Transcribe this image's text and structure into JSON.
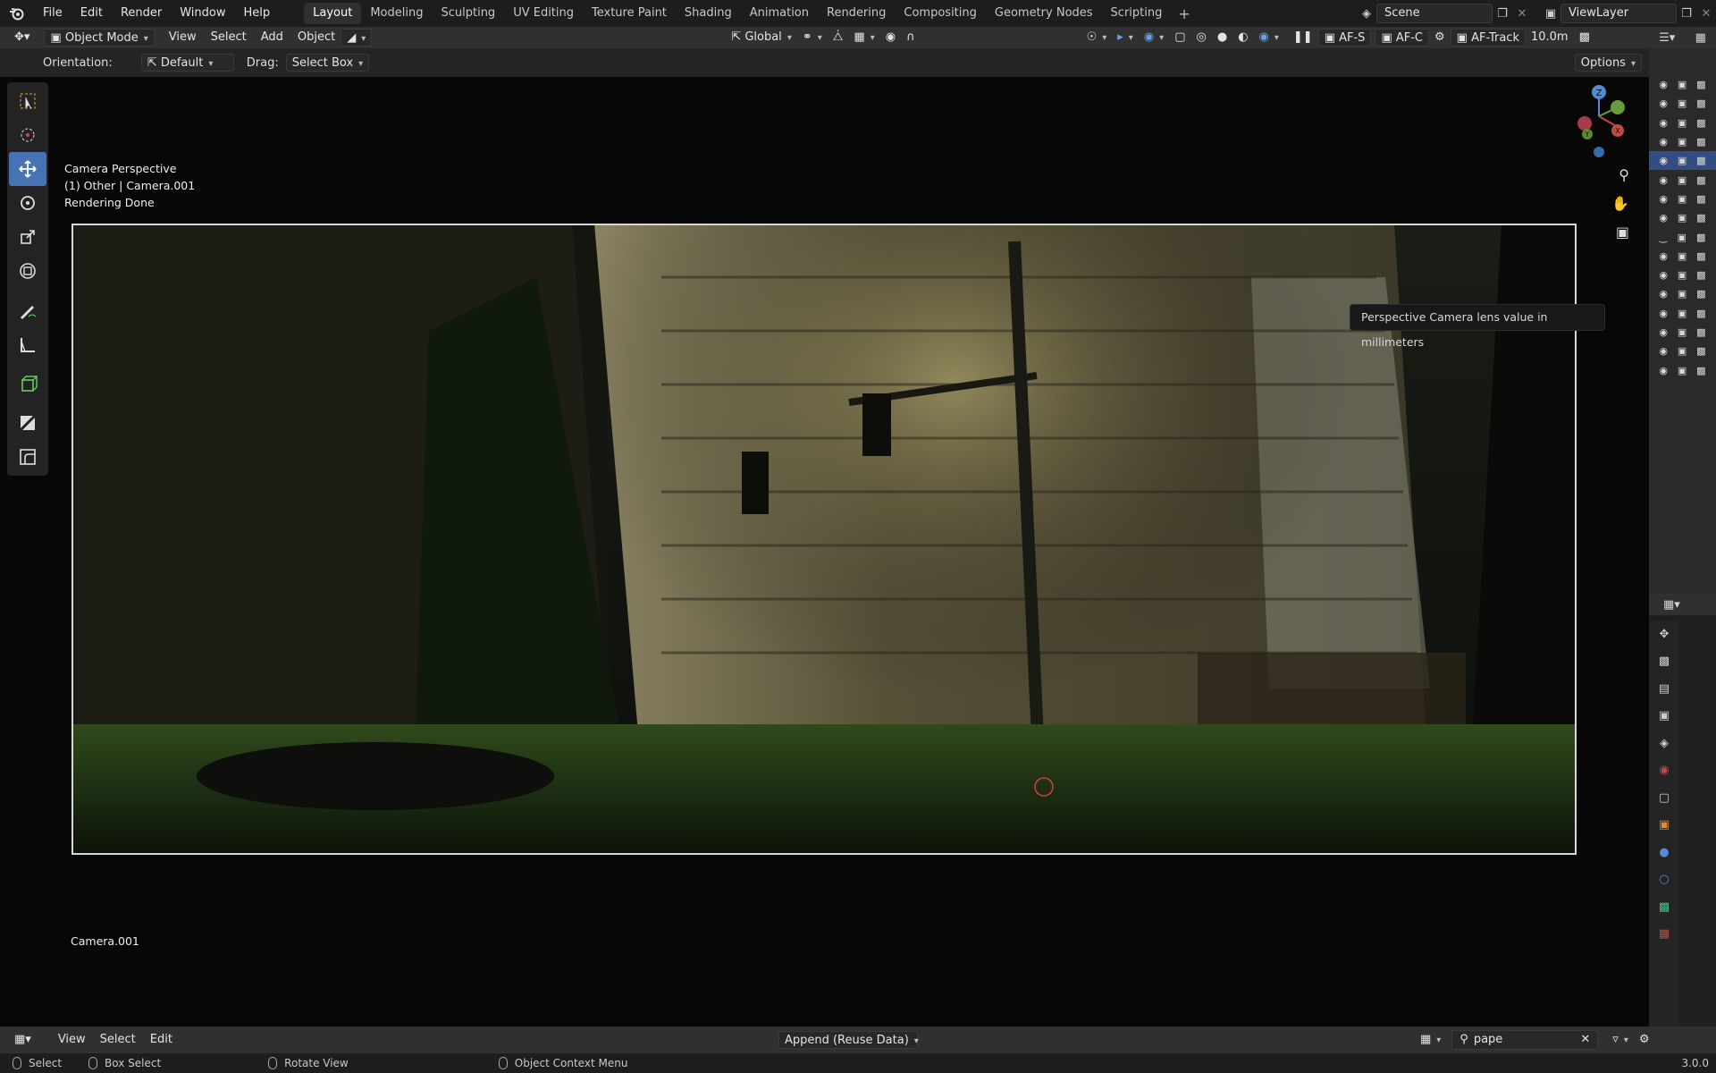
{
  "topbar": {
    "menus": [
      "File",
      "Edit",
      "Render",
      "Window",
      "Help"
    ],
    "workspaces": [
      "Layout",
      "Modeling",
      "Sculpting",
      "UV Editing",
      "Texture Paint",
      "Shading",
      "Animation",
      "Rendering",
      "Compositing",
      "Geometry Nodes",
      "Scripting"
    ],
    "active_workspace": "Layout",
    "scene": "Scene",
    "view_layer": "ViewLayer"
  },
  "header": {
    "mode": "Object Mode",
    "menus": [
      "View",
      "Select",
      "Add",
      "Object"
    ],
    "transform_orientation": "Global",
    "af_s": "AF-S",
    "af_c": "AF-C",
    "af_track": "AF-Track",
    "distance": "10.0m"
  },
  "tool_settings": {
    "orientation_label": "Orientation:",
    "orientation_value": "Default",
    "drag_label": "Drag:",
    "drag_value": "Select Box",
    "options": "Options"
  },
  "viewport": {
    "perspective": "Camera Perspective",
    "collection_info": "(1) Other | Camera.001",
    "render_status": "Rendering Done",
    "camera_name": "Camera.001",
    "tooltip": "Perspective Camera lens value in millimeters"
  },
  "gizmo": {
    "z": "Z",
    "y": "Y",
    "x": "X"
  },
  "timeline": {
    "menus": [
      "View",
      "Select",
      "Edit"
    ],
    "append_mode": "Append (Reuse Data)",
    "search_value": "pape"
  },
  "status_bar": {
    "select": "Select",
    "box_select": "Box Select",
    "rotate_view": "Rotate View",
    "context_menu": "Object Context Menu",
    "version": "3.0.0"
  },
  "colors": {
    "accent": "#4772b3",
    "header": "#303030",
    "topbar": "#1d1d1d"
  }
}
